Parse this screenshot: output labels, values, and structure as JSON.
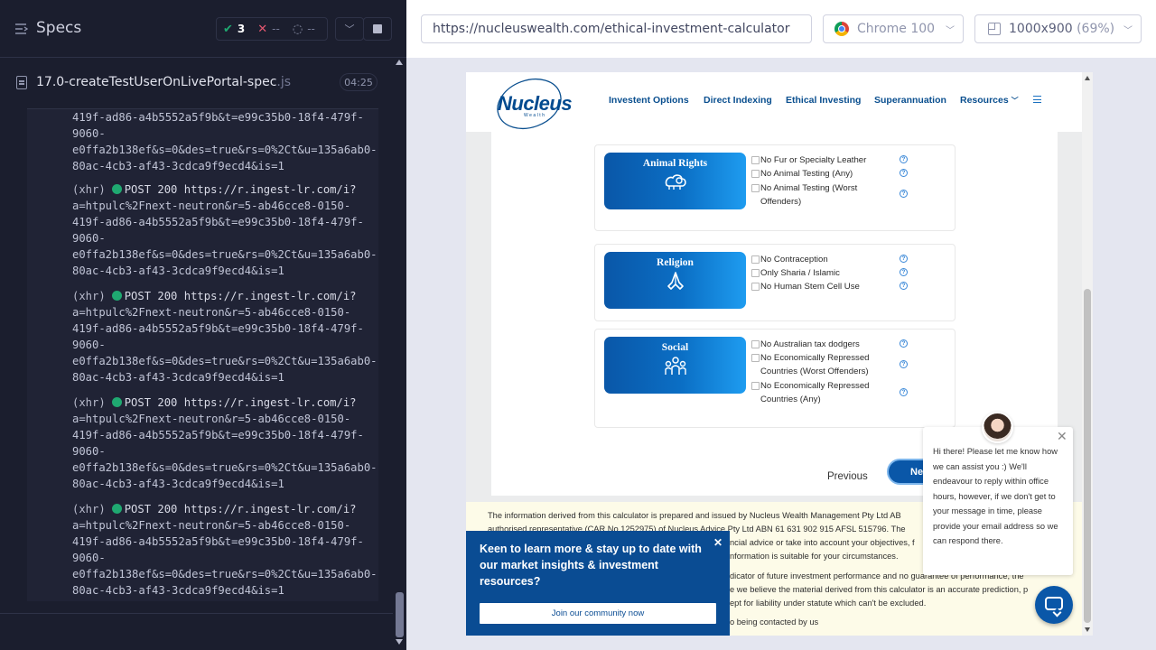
{
  "runner": {
    "specs_title": "Specs",
    "stats": {
      "passed": "3",
      "failed": "--",
      "pending": "--"
    },
    "spec": {
      "name": "17.0-createTestUserOnLivePortal-spec",
      "ext": ".js",
      "duration": "04:25"
    }
  },
  "log": {
    "first_partial": [
      "419f-ad86-a4b5552a5f9b&t=e99c35b0-18f4-479f-",
      "9060-",
      "e0ffa2b138ef&s=0&des=true&rs=0%2Ct&u=135a6ab0-",
      "80ac-4cb3-af43-3cdca9f9ecd4&is=1"
    ],
    "entries": [
      {
        "type": "(xhr)",
        "method": "POST 200",
        "url": "https://r.ingest-lr.com/i?",
        "lines": [
          "a=htpulc%2Fnext-neutron&r=5-ab46cce8-0150-",
          "419f-ad86-a4b5552a5f9b&t=e99c35b0-18f4-479f-",
          "9060-",
          "e0ffa2b138ef&s=0&des=true&rs=0%2Ct&u=135a6ab0-",
          "80ac-4cb3-af43-3cdca9f9ecd4&is=1"
        ]
      },
      {
        "type": "(xhr)",
        "method": "POST 200",
        "url": "https://r.ingest-lr.com/i?",
        "lines": [
          "a=htpulc%2Fnext-neutron&r=5-ab46cce8-0150-",
          "419f-ad86-a4b5552a5f9b&t=e99c35b0-18f4-479f-",
          "9060-",
          "e0ffa2b138ef&s=0&des=true&rs=0%2Ct&u=135a6ab0-",
          "80ac-4cb3-af43-3cdca9f9ecd4&is=1"
        ]
      },
      {
        "type": "(xhr)",
        "method": "POST 200",
        "url": "https://r.ingest-lr.com/i?",
        "lines": [
          "a=htpulc%2Fnext-neutron&r=5-ab46cce8-0150-",
          "419f-ad86-a4b5552a5f9b&t=e99c35b0-18f4-479f-",
          "9060-",
          "e0ffa2b138ef&s=0&des=true&rs=0%2Ct&u=135a6ab0-",
          "80ac-4cb3-af43-3cdca9f9ecd4&is=1"
        ]
      },
      {
        "type": "(xhr)",
        "method": "POST 200",
        "url": "https://r.ingest-lr.com/i?",
        "lines": [
          "a=htpulc%2Fnext-neutron&r=5-ab46cce8-0150-",
          "419f-ad86-a4b5552a5f9b&t=e99c35b0-18f4-479f-",
          "9060-",
          "e0ffa2b138ef&s=0&des=true&rs=0%2Ct&u=135a6ab0-",
          "80ac-4cb3-af43-3cdca9f9ecd4&is=1"
        ]
      }
    ]
  },
  "aut": {
    "url": "https://nucleuswealth.com/ethical-investment-calculator",
    "browser": "Chrome 100",
    "viewport": "1000x900",
    "zoom": "(69%)"
  },
  "site": {
    "logo": {
      "word": "Nucleus",
      "sub": "Wealth"
    },
    "nav": [
      "Investent Options",
      "Direct Indexing",
      "Ethical Investing",
      "Superannuation",
      "Resources"
    ],
    "categories": [
      {
        "title": "Animal Rights",
        "icon": "animal-rights-icon",
        "options": [
          {
            "label": "No Fur or Specialty Leather",
            "checked": false
          },
          {
            "label": "No Animal Testing (Any)",
            "checked": false
          },
          {
            "label": "No Animal Testing (Worst",
            "label2": "Offenders)",
            "checked": false
          }
        ]
      },
      {
        "title": "Religion",
        "icon": "praying-hands-icon",
        "options": [
          {
            "label": "No Contraception",
            "checked": false
          },
          {
            "label": "Only Sharia / Islamic",
            "checked": false
          },
          {
            "label": "No Human Stem Cell Use",
            "checked": false
          }
        ]
      },
      {
        "title": "Social",
        "icon": "people-icon",
        "options": [
          {
            "label": "No Australian tax dodgers",
            "checked": false
          },
          {
            "label": "No Economically Repressed",
            "label2": "Countries (Worst Offenders)",
            "checked": false
          },
          {
            "label": "No Economically Repressed",
            "label2": "Countries (Any)",
            "checked": false
          }
        ]
      }
    ],
    "previous_label": "Previous",
    "next_label": "Ne",
    "disclaimer": [
      "The information derived from this calculator is prepared and issued by Nucleus Wealth Management Pty Ltd AB",
      "authorised representative (CAR No 1252975) of Nucleus Advice Pty Ltd ABN 61 631 902 915 AFSL 515796. The",
      "ncial advice or take into account your objectives, f",
      "nformation is suitable for your circumstances.",
      "dicator of future investment performance and no guarantee of performance, the",
      "e we believe the material derived from this calculator is an accurate prediction, p",
      "ept for liability under statute which can't be excluded.",
      "o being contacted by us"
    ],
    "promo": {
      "text": "Keen to learn more & stay up to date with our market insights & investment resources?",
      "button": "Join our community now"
    },
    "chat": {
      "message": "Hi there! Please let me know how we can assist you :) We'll endeavour to reply within office hours, however, if we don't get to your message in time, please provide your email address so we can respond there."
    }
  }
}
